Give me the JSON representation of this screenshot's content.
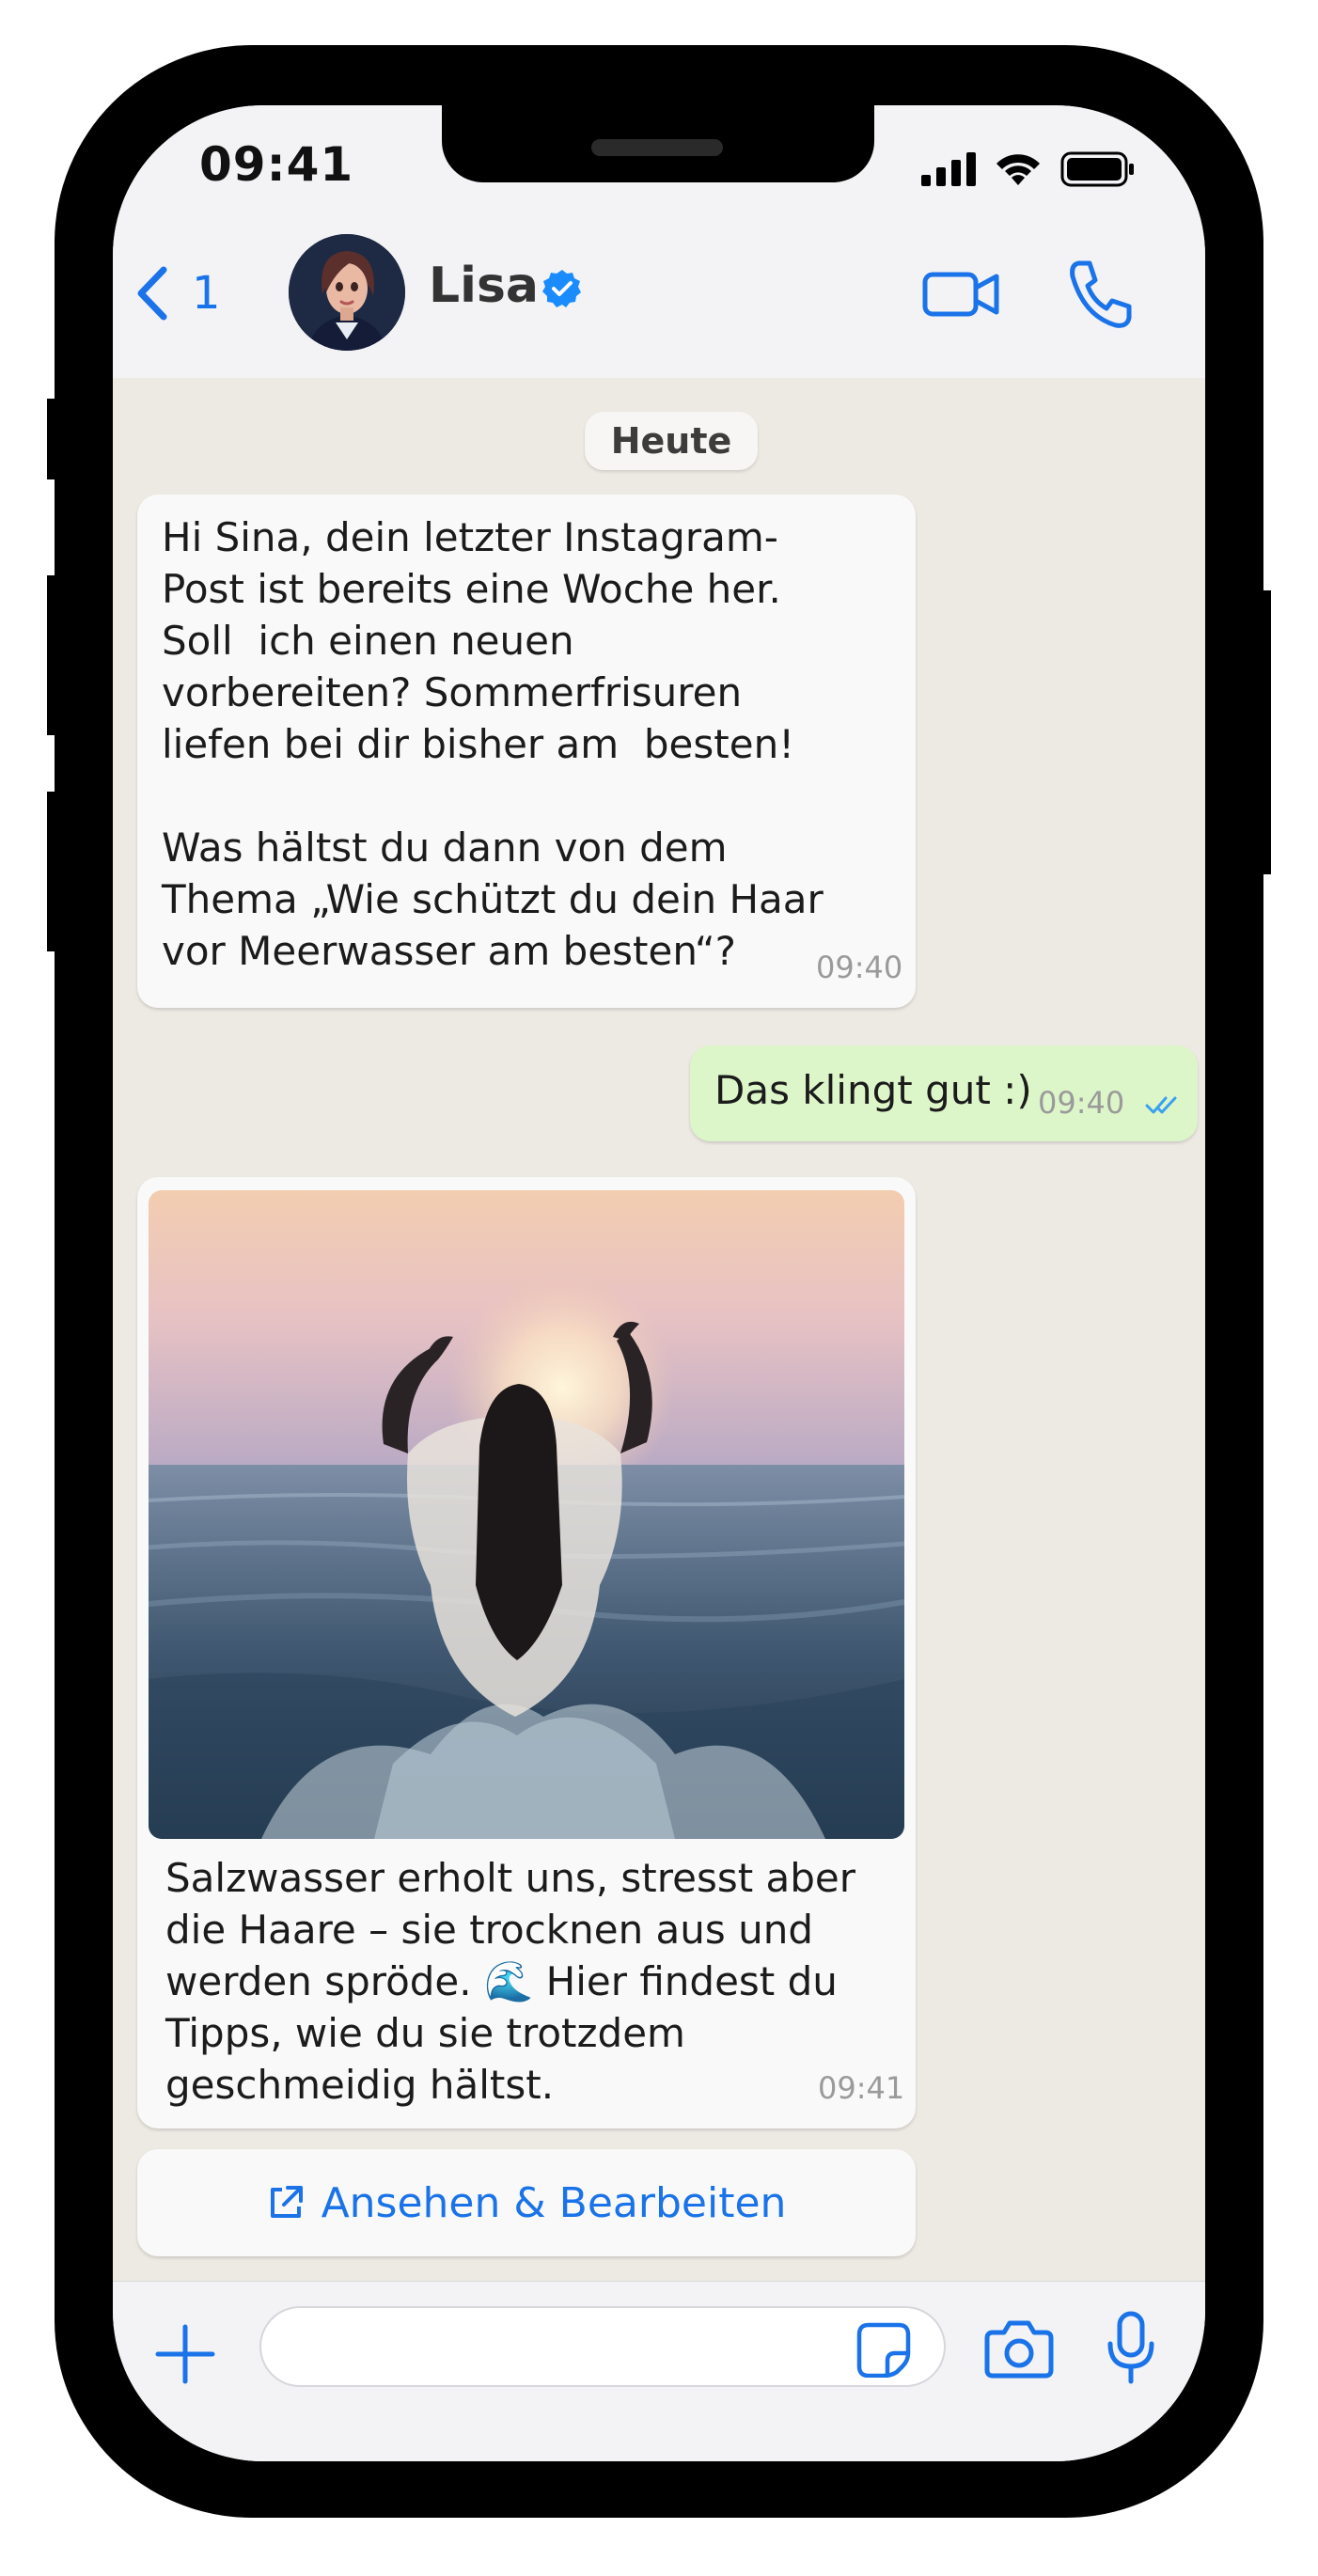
{
  "status_bar": {
    "time": "09:41"
  },
  "header": {
    "back_count": "1",
    "contact_name": "Lisa",
    "icons": [
      "chevron-left-icon",
      "verified-badge-icon",
      "video-call-icon",
      "phone-icon"
    ]
  },
  "chat": {
    "date_label": "Heute",
    "messages": [
      {
        "direction": "incoming",
        "text": "Hi Sina, dein letzter Instagram-\nPost ist bereits eine Woche her.\nSoll  ich einen neuen\nvorbereiten? Sommerfrisuren\nliefen bei dir bisher am  besten!\n\nWas hältst du dann von dem\nThema „Wie schützt du dein Haar\nvor Meerwasser am besten“?",
        "time": "09:40"
      },
      {
        "direction": "outgoing",
        "text": "Das klingt gut :)",
        "time": "09:40",
        "status": "read"
      },
      {
        "direction": "incoming",
        "type": "image",
        "text": "Salzwasser erholt uns, stresst aber\ndie Haare – sie trocknen aus und\nwerden spröde. 🌊 Hier findest du\nTipps, wie du sie trotzdem\ngeschmeidig hältst.",
        "time": "09:41"
      }
    ],
    "action_label": "Ansehen & Bearbeiten"
  },
  "input_bar": {
    "value": "",
    "icons": [
      "plus-icon",
      "sticker-icon",
      "camera-icon",
      "microphone-icon"
    ]
  },
  "colors": {
    "accent": "#1a73e8",
    "chat_background": "#ede9e3",
    "outgoing_bubble": "#ddf6c9",
    "incoming_bubble": "#f9f9f9"
  }
}
